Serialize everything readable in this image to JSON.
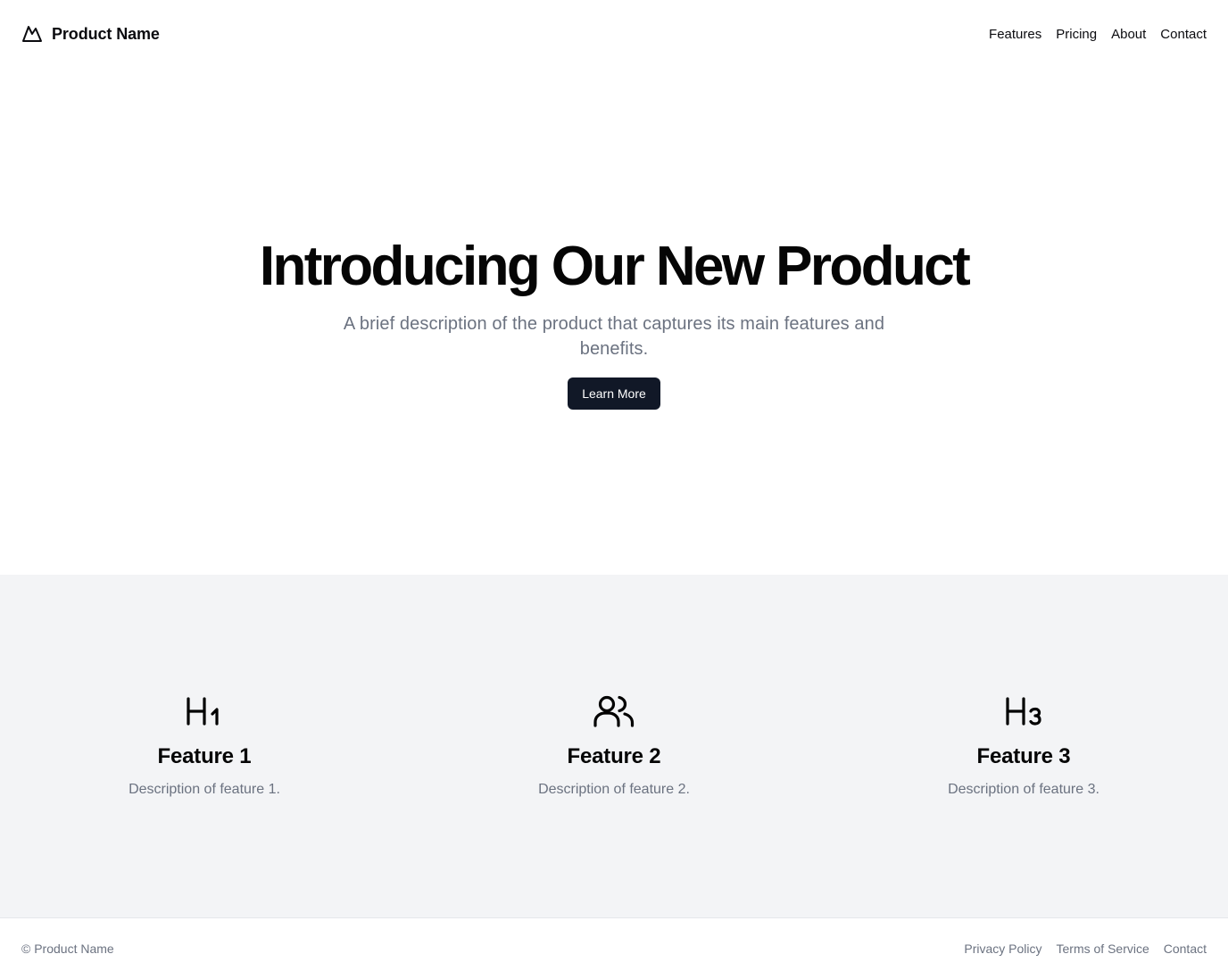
{
  "header": {
    "brand_icon": "mountain-icon",
    "brand_name": "Product Name",
    "nav": [
      {
        "label": "Features"
      },
      {
        "label": "Pricing"
      },
      {
        "label": "About"
      },
      {
        "label": "Contact"
      }
    ]
  },
  "hero": {
    "title": "Introducing Our New Product",
    "description": "A brief description of the product that captures its main features and benefits.",
    "cta_label": "Learn More"
  },
  "features": [
    {
      "icon": "heading-1-icon",
      "title": "Feature 1",
      "description": "Description of feature 1."
    },
    {
      "icon": "users-icon",
      "title": "Feature 2",
      "description": "Description of feature 2."
    },
    {
      "icon": "heading-3-icon",
      "title": "Feature 3",
      "description": "Description of feature 3."
    }
  ],
  "footer": {
    "copyright": "© Product Name",
    "links": [
      {
        "label": "Privacy Policy"
      },
      {
        "label": "Terms of Service"
      },
      {
        "label": "Contact"
      }
    ]
  },
  "colors": {
    "background": "#ffffff",
    "text": "#050505",
    "muted": "#6b7280",
    "button": "#111827",
    "features_bg": "#f3f4f6",
    "border": "#e5e7eb"
  }
}
